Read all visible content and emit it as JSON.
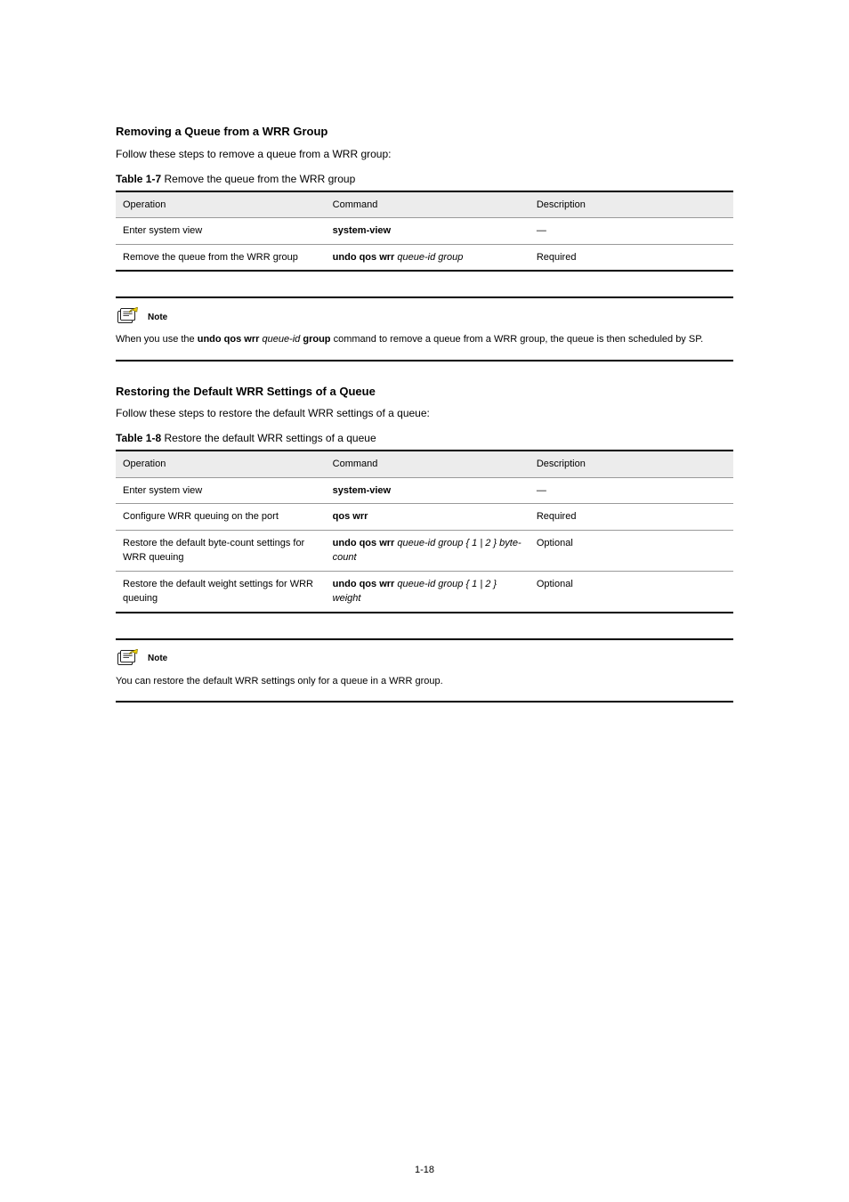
{
  "section1": {
    "heading": "Removing a Queue from a WRR Group",
    "lead": "Follow these steps to remove a queue from a WRR group:",
    "table_caption_no": "Table 1-7",
    "table_caption_desc": "Remove the queue from the WRR group",
    "headers": [
      "Operation",
      "Command",
      "Description"
    ],
    "rows": [
      {
        "op": "Enter system view",
        "cmd_bold": "system-view",
        "cmd_rest": "",
        "desc": "—"
      },
      {
        "op": "Remove the queue from the WRR group",
        "cmd_bold": "undo qos wrr",
        "cmd_rest": " queue-id group",
        "desc": "Required"
      }
    ]
  },
  "note1": {
    "label": "Note",
    "text_before": "When you use the ",
    "text_bold": "undo qos wrr",
    "text_mid": " ",
    "text_italic": "queue-id",
    "text_after_italic": " ",
    "text_bold2": "group",
    "text_after": " command to remove a queue from a WRR group, the queue is then scheduled by SP."
  },
  "section2": {
    "heading": "Restoring the Default WRR Settings of a Queue",
    "lead": "Follow these steps to restore the default WRR settings of a queue:",
    "table_caption_no": "Table 1-8",
    "table_caption_desc": "Restore the default WRR settings of a queue",
    "headers": [
      "Operation",
      "Command",
      "Description"
    ],
    "rows": [
      {
        "op": "Enter system view",
        "cmd_bold": "system-view",
        "cmd_rest": "",
        "desc": "—"
      },
      {
        "op": "Configure WRR queuing on the port",
        "cmd_bold": "qos wrr",
        "cmd_rest": "",
        "desc": "Required"
      },
      {
        "op": "Restore the default byte-count settings for WRR queuing",
        "cmd_bold": "undo qos wrr",
        "cmd_rest": " queue-id group { 1 | 2 } byte-count",
        "desc": "Optional"
      },
      {
        "op": "Restore the default weight settings for WRR queuing",
        "cmd_bold": "undo qos wrr",
        "cmd_rest": " queue-id group { 1 | 2 } weight",
        "desc": "Optional"
      }
    ]
  },
  "note2": {
    "label": "Note",
    "text": "You can restore the default WRR settings only for a queue in a WRR group."
  },
  "page_number": "1-18"
}
